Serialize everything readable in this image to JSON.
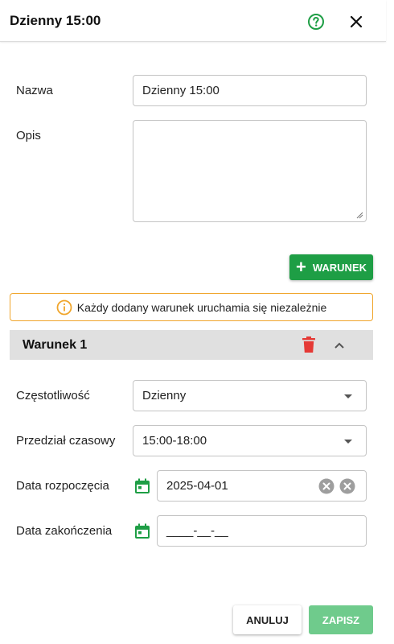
{
  "header": {
    "title": "Dzienny 15:00",
    "help_icon": "help-circle-icon",
    "close_icon": "close-icon"
  },
  "form": {
    "name_label": "Nazwa",
    "name_value": "Dzienny 15:00",
    "description_label": "Opis",
    "description_value": ""
  },
  "add_condition_label": "WARUNEK",
  "info_text": "Każdy dodany warunek uruchamia się niezależnie",
  "condition": {
    "title": "Warunek 1",
    "frequency_label": "Częstotliwość",
    "frequency_value": "Dzienny",
    "timerange_label": "Przedział czasowy",
    "timerange_value": "15:00-18:00",
    "start_label": "Data rozpoczęcia",
    "start_value": "2025-04-01",
    "end_label": "Data zakończenia",
    "end_value": "____-__-__"
  },
  "footer": {
    "cancel_label": "ANULUJ",
    "save_label": "ZAPISZ"
  },
  "colors": {
    "accent_green": "#1e9e45",
    "save_disabled": "#6fcb8c",
    "warning_border": "#f0a52b",
    "delete_red": "#e53935"
  }
}
